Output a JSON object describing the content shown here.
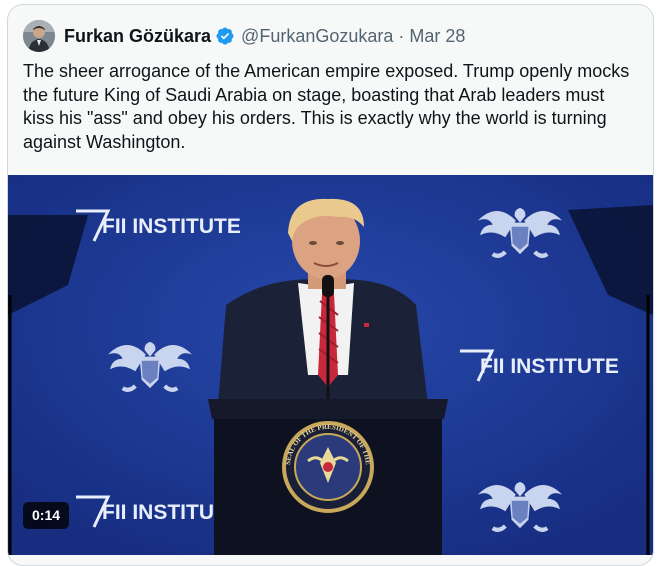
{
  "tweet": {
    "author_name": "Furkan Gözükara",
    "handle": "@FurkanGozukara",
    "separator": "·",
    "date": "Mar 28",
    "text": "The sheer arrogance of the American empire exposed. Trump openly mocks the future King of Saudi Arabia on stage, boasting that Arab leaders must kiss his \"ass\" and obey his orders. This is exactly why the world is turning against Washington.",
    "verified": true
  },
  "media": {
    "banner_text_1": "FII INSTITUTE",
    "banner_text_2": "FII INSTITUTE",
    "banner_text_3": "FII INSTITUTE",
    "duration": "0:14",
    "seal_text": "SEAL OF THE PRESIDENT OF THE UNITED STATES"
  },
  "colors": {
    "verified_badge": "#1d9bf0",
    "backdrop_blue": "#1e3a9a",
    "secondary_text": "#536471"
  },
  "icons": [
    "avatar",
    "verified-badge-icon",
    "eagle-emblem-icon",
    "presidential-seal-icon"
  ]
}
